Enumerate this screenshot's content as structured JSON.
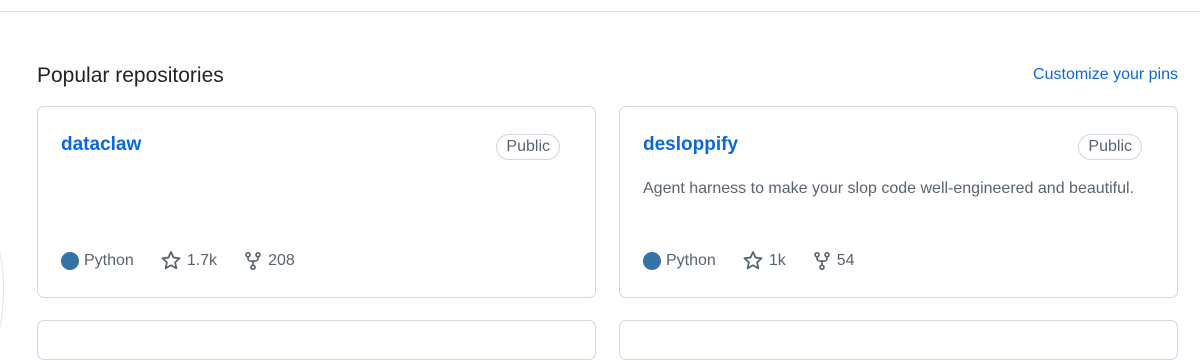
{
  "section": {
    "title": "Popular repositories",
    "customize_link": "Customize your pins"
  },
  "colors": {
    "link": "#0969da",
    "python": "#3572A5",
    "border": "#d0d7de",
    "muted": "#59636e"
  },
  "repos": [
    {
      "name": "dataclaw",
      "visibility": "Public",
      "description": "",
      "language": "Python",
      "stars": "1.7k",
      "forks": "208"
    },
    {
      "name": "desloppify",
      "visibility": "Public",
      "description": "Agent harness to make your slop code well-engineered and beautiful.",
      "language": "Python",
      "stars": "1k",
      "forks": "54"
    }
  ],
  "icons": {
    "star": "star-icon",
    "fork": "repo-forked-icon",
    "language_dot": "language-color-dot"
  }
}
